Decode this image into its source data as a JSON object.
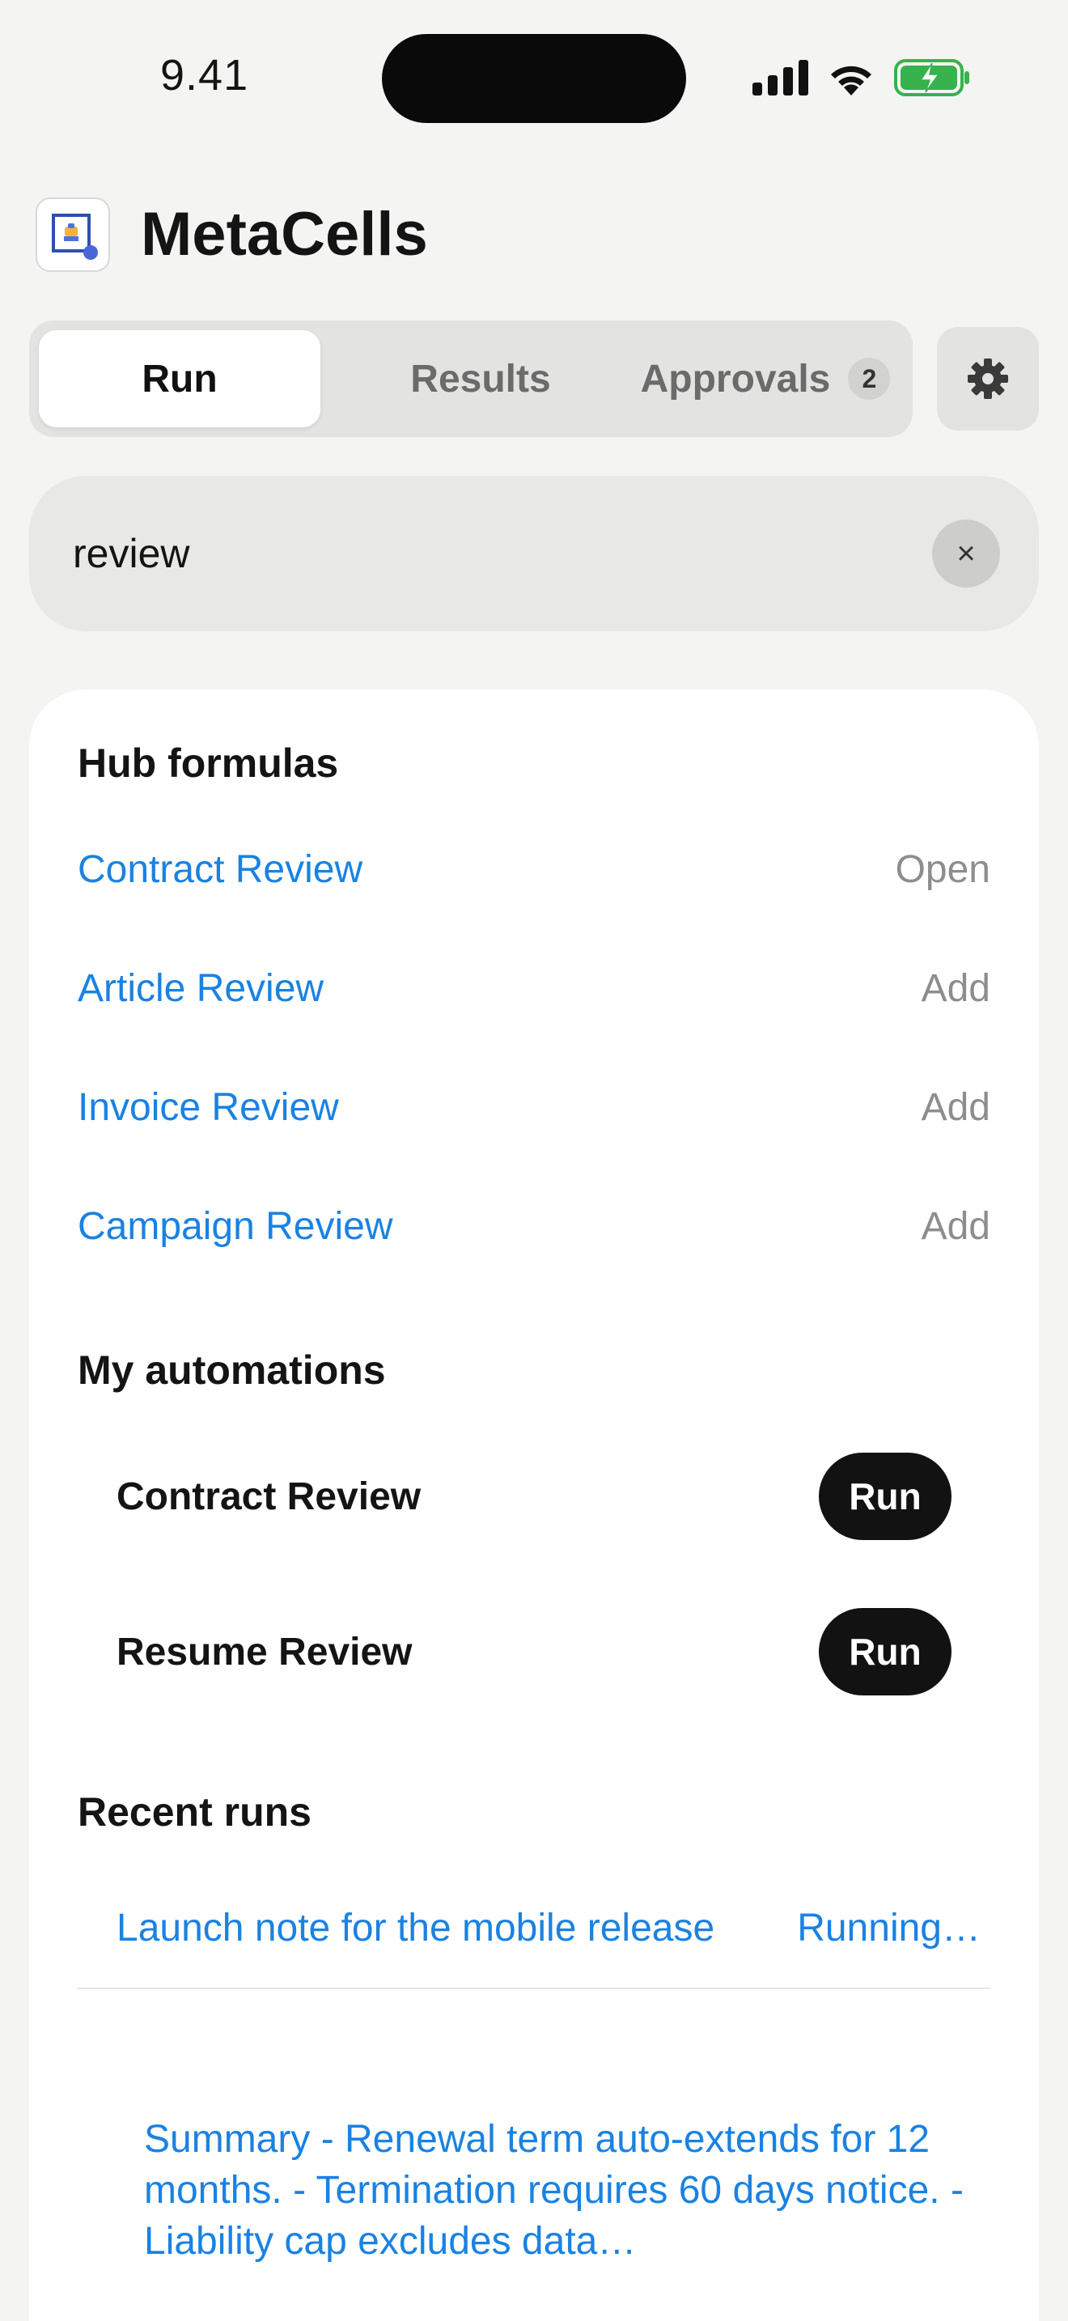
{
  "status_bar": {
    "time": "9.41"
  },
  "header": {
    "app_title": "MetaCells",
    "icon": "app-logo-icon"
  },
  "tabs": [
    {
      "label": "Run",
      "active": true
    },
    {
      "label": "Results",
      "active": false
    },
    {
      "label": "Approvals",
      "active": false,
      "badge": "2"
    }
  ],
  "settings": {
    "icon": "gear-icon"
  },
  "search": {
    "value": "review",
    "clear_icon": "×"
  },
  "hub_formulas": {
    "title": "Hub formulas",
    "items": [
      {
        "name": "Contract Review",
        "action": "Open"
      },
      {
        "name": "Article Review",
        "action": "Add"
      },
      {
        "name": "Invoice Review",
        "action": "Add"
      },
      {
        "name": "Campaign Review",
        "action": "Add"
      }
    ]
  },
  "my_automations": {
    "title": "My automations",
    "items": [
      {
        "name": "Contract Review",
        "button": "Run"
      },
      {
        "name": "Resume Review",
        "button": "Run"
      }
    ]
  },
  "recent_runs": {
    "title": "Recent runs",
    "items": [
      {
        "title": "Launch note for the mobile release",
        "status": "Running…"
      }
    ],
    "summary": "Summary - Renewal term auto-extends for 12 months. - Termination requires 60 days notice. - Liability cap excludes data…"
  },
  "colors": {
    "accent": "#1a82e2",
    "background": "#f4f4f2",
    "card": "#ffffff",
    "button_dark": "#121212"
  }
}
